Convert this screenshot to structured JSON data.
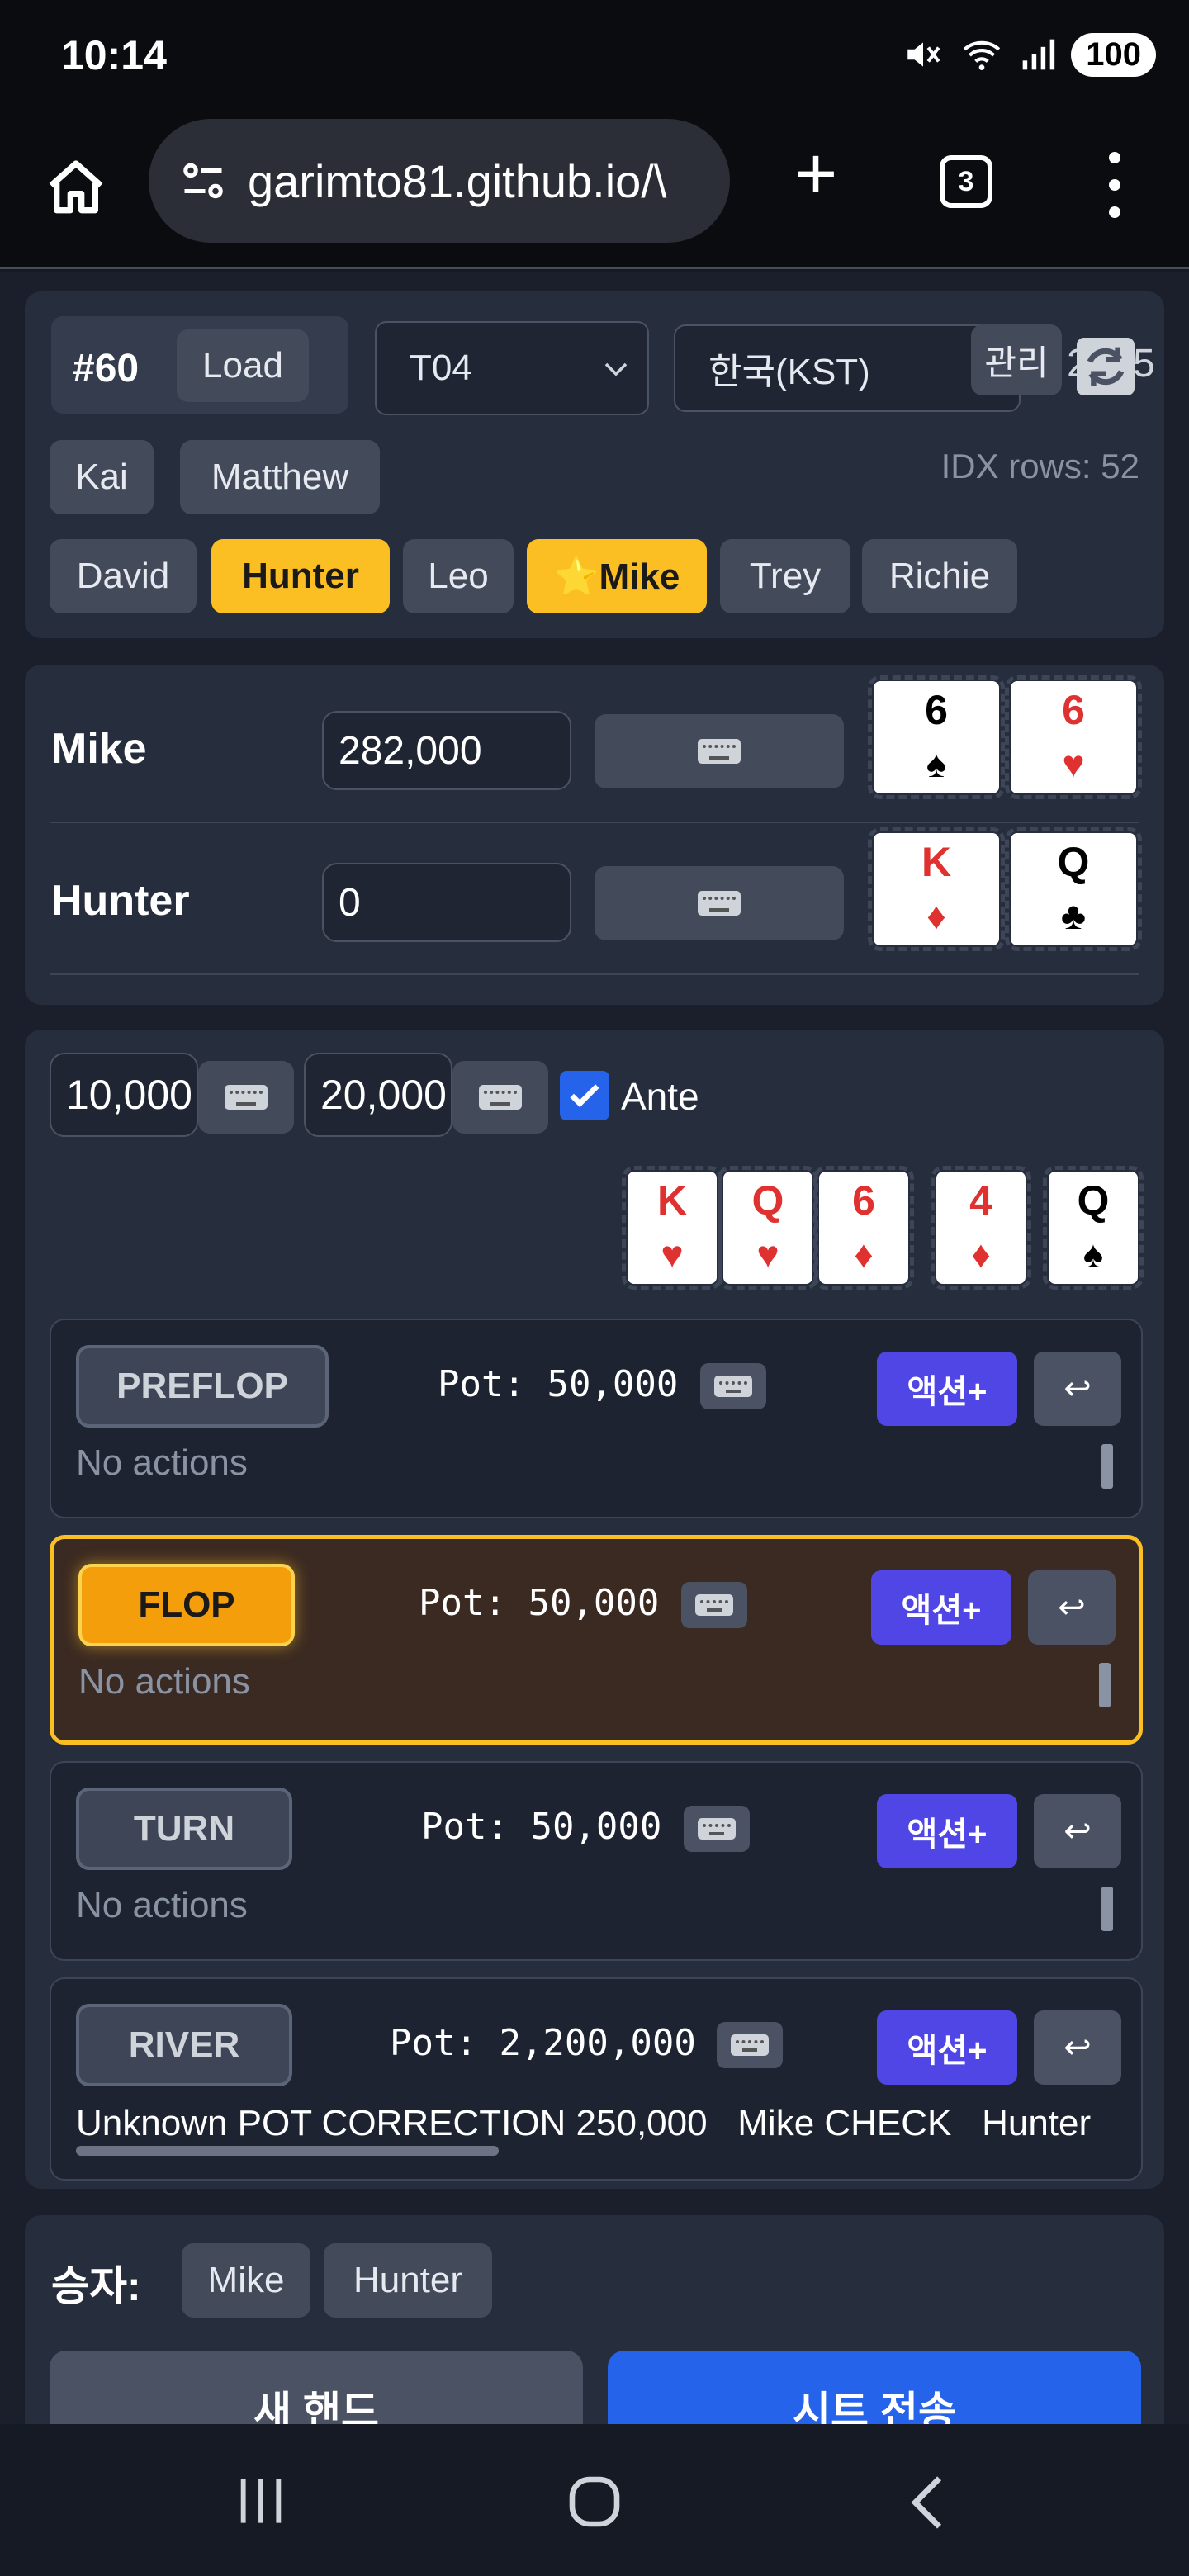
{
  "status": {
    "time": "10:14",
    "battery": "100"
  },
  "browser": {
    "url": "garimto81.github.io/\\",
    "tab_count": "3"
  },
  "top": {
    "hand_no": "#60",
    "load_label": "Load",
    "table_select": "T04",
    "tz_select": "한국(KST)",
    "admin_label": "관리",
    "clock_partial": "2 4:5",
    "idx_rows": "IDX rows: 52",
    "players_row1": [
      "Kai",
      "Matthew"
    ],
    "players_row2": [
      "David",
      "Hunter",
      "Leo",
      "⭐Mike",
      "Trey",
      "Richie"
    ]
  },
  "seats": [
    {
      "name": "Mike",
      "stack": "282,000",
      "cards": [
        {
          "rank": "6",
          "suit": "♠",
          "color": "black"
        },
        {
          "rank": "6",
          "suit": "♥",
          "color": "red"
        }
      ]
    },
    {
      "name": "Hunter",
      "stack": "0",
      "cards": [
        {
          "rank": "K",
          "suit": "♦",
          "color": "red"
        },
        {
          "rank": "Q",
          "suit": "♣",
          "color": "black"
        }
      ]
    }
  ],
  "blinds": {
    "sb": "10,000",
    "bb": "20,000",
    "ante_label": "Ante",
    "ante_checked": true
  },
  "board": [
    {
      "rank": "K",
      "suit": "♥",
      "color": "red"
    },
    {
      "rank": "Q",
      "suit": "♥",
      "color": "red"
    },
    {
      "rank": "6",
      "suit": "♦",
      "color": "red"
    },
    {
      "rank": "4",
      "suit": "♦",
      "color": "red"
    },
    {
      "rank": "Q",
      "suit": "♠",
      "color": "black"
    }
  ],
  "streets": [
    {
      "label": "PREFLOP",
      "pot": "Pot: 50,000",
      "actions_text": "No actions",
      "action_label": "액션+",
      "undo": "↩"
    },
    {
      "label": "FLOP",
      "pot": "Pot: 50,000",
      "actions_text": "No actions",
      "action_label": "액션+",
      "undo": "↩"
    },
    {
      "label": "TURN",
      "pot": "Pot: 50,000",
      "actions_text": "No actions",
      "action_label": "액션+",
      "undo": "↩"
    },
    {
      "label": "RIVER",
      "pot": "Pot: 2,200,000",
      "actions_text": "Unknown POT CORRECTION 250,000   Mike CHECK   Hunter",
      "action_label": "액션+",
      "undo": "↩"
    }
  ],
  "winner": {
    "label": "승자:",
    "options": [
      "Mike",
      "Hunter"
    ]
  },
  "bottom": {
    "new_hand": "새 핸드",
    "submit": "시트 전송"
  },
  "colors": {
    "accent_yellow": "#fbbf24",
    "action_purple": "#4f46e5",
    "submit_blue": "#2563eb"
  }
}
